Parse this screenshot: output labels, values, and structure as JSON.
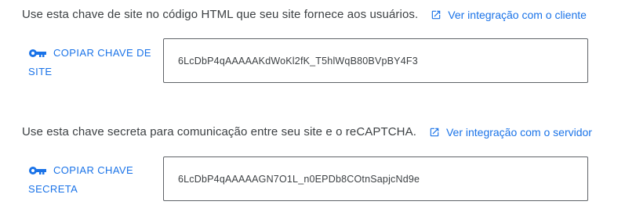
{
  "site_key_section": {
    "description": "Use esta chave de site no código HTML que seu site fornece aos usuários.",
    "link_label": "Ver integração com o cliente",
    "link_icon": "open-in-new-icon",
    "copy_button_label": "COPIAR CHAVE DE SITE",
    "copy_button_icon": "key-icon",
    "key_value": "6LcDbP4qAAAAAKdWoKl2fK_T5hlWqB80BVpBY4F3"
  },
  "secret_key_section": {
    "description": "Use esta chave secreta para comunicação entre seu site e o reCAPTCHA.",
    "link_label": "Ver integração com o servidor",
    "link_icon": "open-in-new-icon",
    "copy_button_label": "COPIAR CHAVE SECRETA",
    "copy_button_icon": "key-icon",
    "key_value": "6LcDbP4qAAAAAGN7O1L_n0EPDb8COtnSapjcNd9e"
  },
  "colors": {
    "accent": "#1a73e8",
    "text": "#3c4043",
    "border": "#5f6368"
  }
}
